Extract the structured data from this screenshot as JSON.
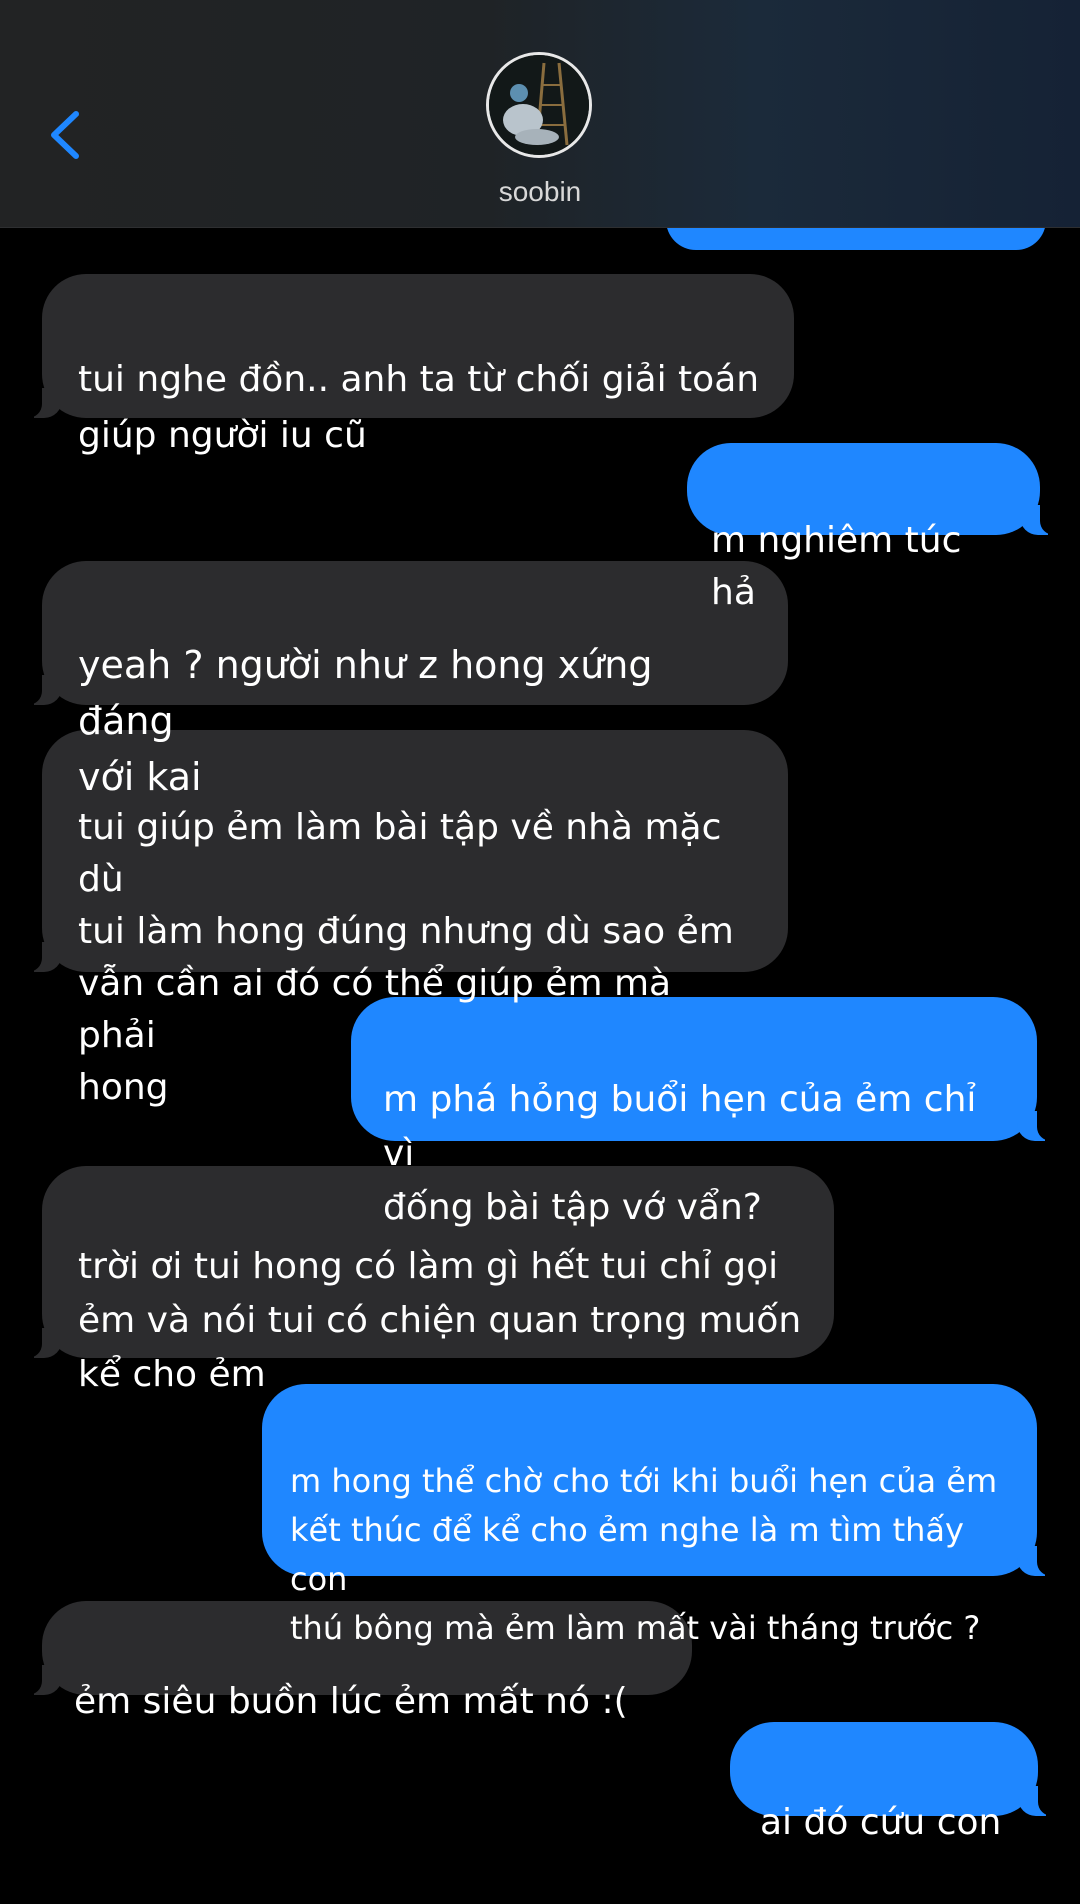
{
  "header": {
    "contact_name": "soobin",
    "back_icon": "chevron-left-icon",
    "accent_color": "#1f87ff"
  },
  "messages": [
    {
      "from": "them",
      "text": "tui nghe đồn.. anh ta từ chối giải toán\ngiúp người iu cũ"
    },
    {
      "from": "me",
      "text": "m nghiêm túc hả"
    },
    {
      "from": "them",
      "text": "yeah ? người như z hong xứng đáng\nvới kai"
    },
    {
      "from": "them",
      "text": "tui giúp ẻm làm bài tập về nhà mặc dù\ntui làm hong đúng nhưng dù sao ẻm\nvẫn cần ai đó có thể giúp ẻm mà phải\nhong"
    },
    {
      "from": "me",
      "text": "m phá hỏng buổi hẹn của ẻm chỉ vì\nđống bài tập vớ vẩn?"
    },
    {
      "from": "them",
      "text": "trời ơi tui hong có làm gì hết tui chỉ gọi\nẻm và nói tui có chiện quan trọng muốn\nkể cho ẻm"
    },
    {
      "from": "me",
      "text": "m hong thể chờ cho tới khi buổi hẹn của ẻm\nkết thúc để kể cho ẻm nghe là m tìm thấy con\nthú bông mà ẻm làm mất vài tháng trước ?"
    },
    {
      "from": "them",
      "text": "ẻm siêu buồn lúc ẻm mất nó :("
    },
    {
      "from": "me",
      "text": "ai đó cứu con"
    }
  ]
}
